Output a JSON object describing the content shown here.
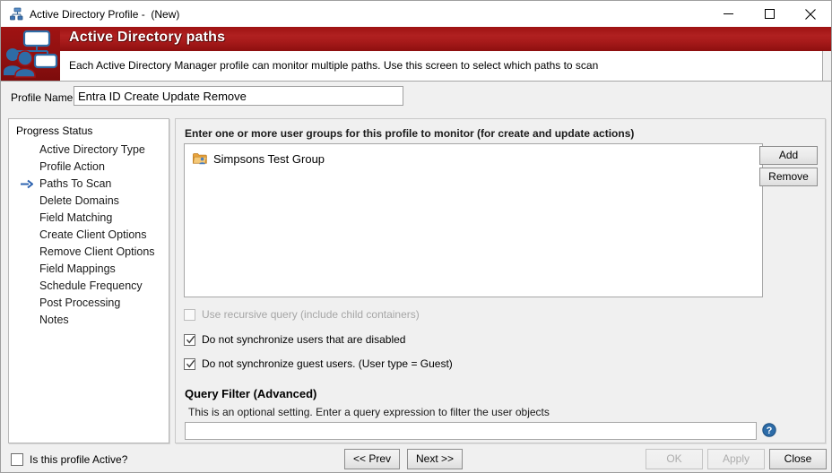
{
  "window": {
    "title": "Active Directory Profile -  (New)",
    "icon": "active-directory-icon",
    "controls": {
      "minimize": "minimize-icon",
      "maximize": "maximize-icon",
      "close": "close-icon"
    }
  },
  "header": {
    "title": "Active Directory paths",
    "description": "Each Active Directory Manager profile can monitor multiple paths.  Use this screen to select which paths to scan",
    "icon": "org-chart-people-icon",
    "accent_color": "#a01313"
  },
  "profile": {
    "label": "Profile Name",
    "value": "Entra ID Create Update Remove",
    "placeholder": ""
  },
  "progress": {
    "title": "Progress Status",
    "current": "Paths To Scan",
    "items": [
      {
        "label": "Active Directory Type",
        "current": false
      },
      {
        "label": "Profile Action",
        "current": false
      },
      {
        "label": "Paths To Scan",
        "current": true
      },
      {
        "label": "Delete Domains",
        "current": false
      },
      {
        "label": "Field Matching",
        "current": false
      },
      {
        "label": "Create Client Options",
        "current": false
      },
      {
        "label": "Remove Client Options",
        "current": false
      },
      {
        "label": "Field Mappings",
        "current": false
      },
      {
        "label": "Schedule Frequency",
        "current": false
      },
      {
        "label": "Post Processing",
        "current": false
      },
      {
        "label": "Notes",
        "current": false
      }
    ]
  },
  "main": {
    "groups_caption": "Enter one or more user groups for this profile to monitor (for create and update actions)",
    "groups": [
      {
        "label": "Simpsons Test Group",
        "icon": "folder-user-icon"
      }
    ],
    "buttons": {
      "add": "Add",
      "remove": "Remove"
    },
    "options": [
      {
        "label": "Use recursive query (include child containers)",
        "checked": false,
        "enabled": false,
        "name": "use-recursive-query"
      },
      {
        "label": "Do not synchronize users that are disabled",
        "checked": true,
        "enabled": true,
        "name": "no-sync-disabled-users"
      },
      {
        "label": "Do not synchronize guest users. (User type = Guest)",
        "checked": true,
        "enabled": true,
        "name": "no-sync-guest-users"
      }
    ],
    "query_filter": {
      "title": "Query Filter (Advanced)",
      "help_text": "This is an optional  setting.  Enter a query expression to filter the user objects",
      "value": "",
      "placeholder": "",
      "help_icon": "help-circle-icon"
    }
  },
  "footer": {
    "active_checkbox": {
      "label": "Is this profile Active?",
      "checked": false
    },
    "buttons": {
      "prev": "<< Prev",
      "next": "Next >>",
      "ok": "OK",
      "apply": "Apply",
      "close": "Close"
    },
    "disabled_buttons": [
      "OK",
      "Apply"
    ]
  }
}
